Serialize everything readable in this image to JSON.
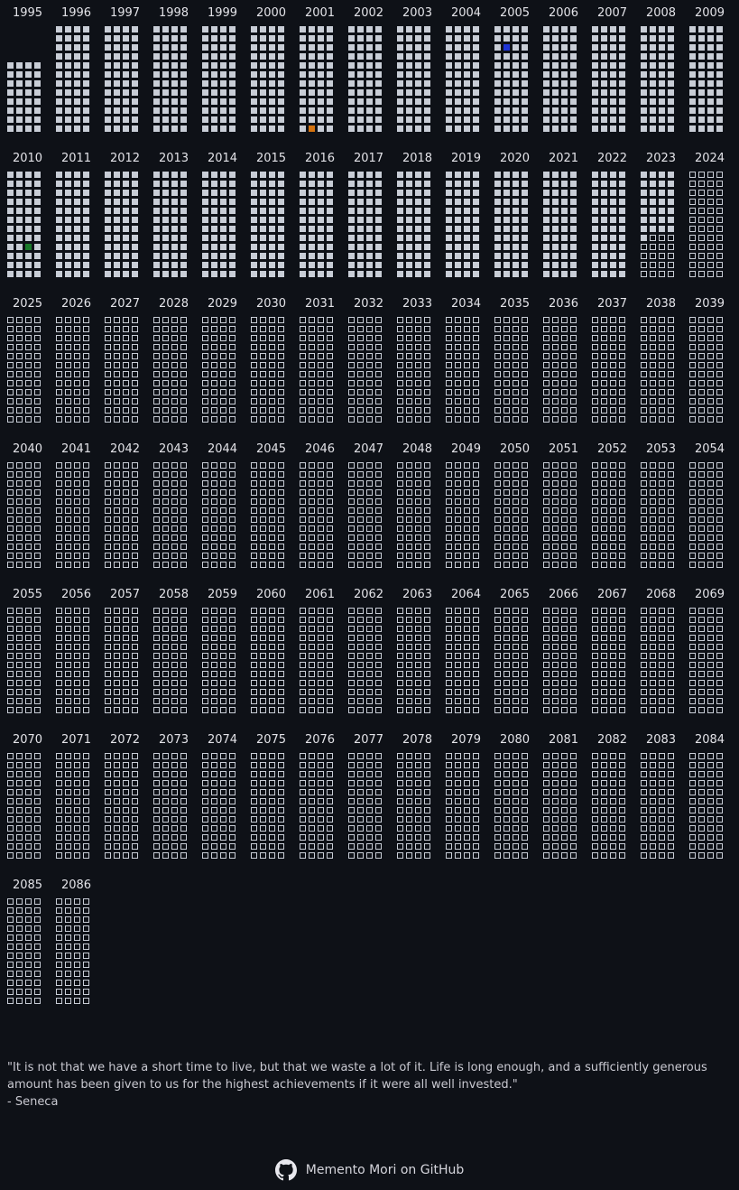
{
  "grid": {
    "start_year": 1995,
    "end_year": 2086,
    "years_per_row": 15,
    "cols_per_year": 4,
    "rows_per_year": 12,
    "first_year_filled_rows": 8,
    "current_year": 2023,
    "current_year_filled_weeks": 29,
    "colors": {
      "lived": "#c8cdd6",
      "future_outline": "#c8cdd6",
      "background": "#0e1117"
    },
    "highlights": [
      {
        "year": 2001,
        "index": 45,
        "color": "#d5730f"
      },
      {
        "year": 2005,
        "index": 9,
        "color": "#1f35d6"
      },
      {
        "year": 2010,
        "index": 34,
        "color": "#1a7a2a"
      }
    ]
  },
  "quote": {
    "text": "\"It is not that we have a short time to live, but that we waste a lot of it. Life is long enough, and a sufficiently generous amount has been given to us for the highest achievements if it were all well invested.\"",
    "author": "- Seneca"
  },
  "footer": {
    "link_text": "Memento Mori on GitHub",
    "icon": "github-icon"
  }
}
